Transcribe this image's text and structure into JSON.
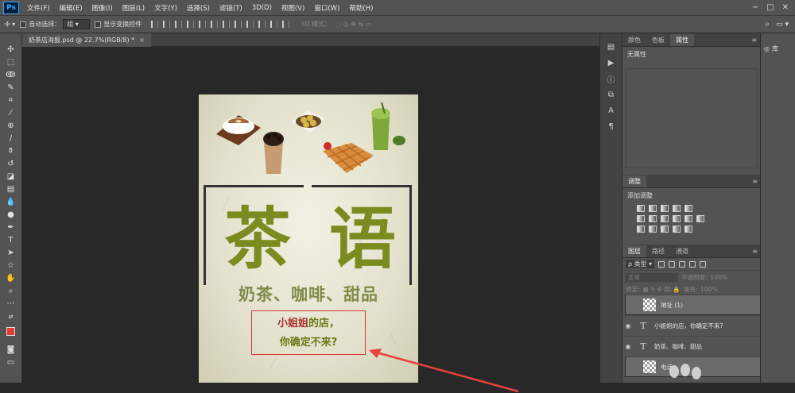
{
  "app": {
    "logo": "Ps"
  },
  "menu": [
    "文件(F)",
    "编辑(E)",
    "图像(I)",
    "图层(L)",
    "文字(Y)",
    "选择(S)",
    "滤镜(T)",
    "3D(D)",
    "视图(V)",
    "窗口(W)",
    "帮助(H)"
  ],
  "options": {
    "auto_select_label": "自动选择：",
    "auto_select_value": "组",
    "show_transform_label": "显示变换控件",
    "mode_3d": "3D 模式："
  },
  "document": {
    "tab_title": "奶茶店海报.psd @ 22.7%(RGB/8) *",
    "close": "×"
  },
  "poster": {
    "char1": "茶",
    "char2": "语",
    "subtitle": "奶茶、咖啡、甜品",
    "tagline_line1_accent": "小姐姐",
    "tagline_line1_rest": "的店，",
    "tagline_line2": "你确定不来?"
  },
  "panels": {
    "top_tabs": [
      "颜色",
      "色板",
      "属性"
    ],
    "properties_text": "无属性",
    "adjust_tab": "调整",
    "adjust_label": "添加调整",
    "layers_tabs": [
      "图层",
      "路径",
      "通道"
    ],
    "filter_kind": "ρ 类型",
    "blend_mode": "正常",
    "opacity_label": "不透明度:",
    "opacity_value": "100%",
    "lock_label": "锁定:",
    "fill_label": "填充:",
    "fill_value": "100%",
    "layers": [
      {
        "name": "地址 (1)",
        "type": "image",
        "visible": false
      },
      {
        "name": "小姐姐的店，你确定不来?",
        "type": "text",
        "visible": true
      },
      {
        "name": "奶茶、咖啡、甜品",
        "type": "text",
        "visible": true
      },
      {
        "name": "电话",
        "type": "image",
        "visible": false
      }
    ]
  },
  "library": {
    "label": "库"
  },
  "colors": {
    "foreground": "#e43d30",
    "background": "#ffffff",
    "tagline_box": "#d9343a",
    "char_green": "#7a8c1f"
  }
}
